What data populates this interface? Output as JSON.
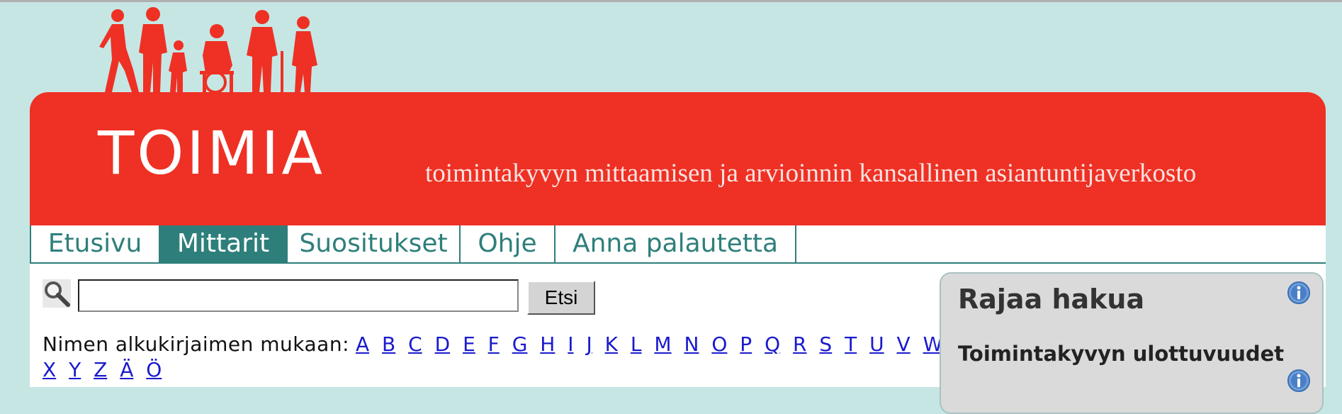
{
  "header": {
    "logo": "TOIMIA",
    "tagline": "toimintakyvyn mittaamisen ja arvioinnin kansallinen asiantuntijaverkosto"
  },
  "nav": {
    "tabs": [
      {
        "label": "Etusivu",
        "active": false
      },
      {
        "label": "Mittarit",
        "active": true
      },
      {
        "label": "Suositukset",
        "active": false
      },
      {
        "label": "Ohje",
        "active": false
      },
      {
        "label": "Anna palautetta",
        "active": false
      }
    ]
  },
  "search": {
    "value": "",
    "placeholder": "",
    "button_label": "Etsi"
  },
  "alphabet": {
    "label": "Nimen alkukirjaimen mukaan:",
    "letters": [
      "A",
      "B",
      "C",
      "D",
      "E",
      "F",
      "G",
      "H",
      "I",
      "J",
      "K",
      "L",
      "M",
      "N",
      "O",
      "P",
      "Q",
      "R",
      "S",
      "T",
      "U",
      "V",
      "W",
      "X",
      "Y",
      "Z",
      "Ä",
      "Ö"
    ]
  },
  "filter_panel": {
    "title": "Rajaa hakua",
    "section": "Toimintakyvyn ulottuvuudet"
  },
  "colors": {
    "background": "#c6e6e4",
    "banner": "#ee3124",
    "nav_accent": "#2e7f7b",
    "link": "#1a1acc"
  },
  "icons": [
    "people-silhouette-icon",
    "search-icon",
    "info-icon"
  ]
}
